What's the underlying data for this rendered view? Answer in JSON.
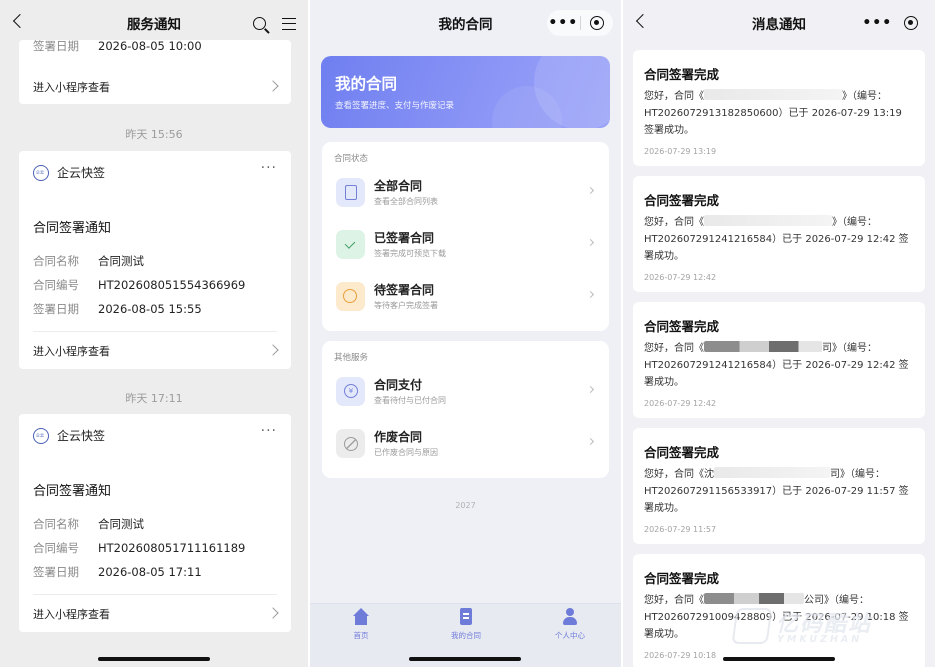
{
  "panel1": {
    "title": "服务通知",
    "cut_row": {
      "label": "签署日期",
      "value": "2026-08-05 10:00"
    },
    "top_link": "进入小程序查看",
    "notices": [
      {
        "time": "昨天 15:56",
        "sender": "企云快签",
        "more": "···",
        "title": "合同签署通知",
        "fields": [
          {
            "label": "合同名称",
            "value": "合同测试"
          },
          {
            "label": "合同编号",
            "value": "HT202608051554366969"
          },
          {
            "label": "签署日期",
            "value": "2026-08-05 15:55"
          }
        ],
        "link": "进入小程序查看"
      },
      {
        "time": "昨天 17:11",
        "sender": "企云快签",
        "more": "···",
        "title": "合同签署通知",
        "fields": [
          {
            "label": "合同名称",
            "value": "合同测试"
          },
          {
            "label": "合同编号",
            "value": "HT202608051711161189"
          },
          {
            "label": "签署日期",
            "value": "2026-08-05 17:11"
          }
        ],
        "link": "进入小程序查看"
      }
    ]
  },
  "panel2": {
    "title": "我的合同",
    "capsule_dots": "•••",
    "hero": {
      "title": "我的合同",
      "subtitle": "查看签署进度、支付与作废记录"
    },
    "status_section": {
      "title": "合同状态",
      "items": [
        {
          "label": "全部合同",
          "desc": "查看全部合同列表",
          "icon": "document-icon"
        },
        {
          "label": "已签署合同",
          "desc": "签署完成可预览下载",
          "icon": "check-icon"
        },
        {
          "label": "待签署合同",
          "desc": "等待客户完成签署",
          "icon": "clock-icon"
        }
      ]
    },
    "other_section": {
      "title": "其他服务",
      "items": [
        {
          "label": "合同支付",
          "desc": "查看待付与已付合同",
          "icon": "yuan-icon"
        },
        {
          "label": "作废合同",
          "desc": "已作废合同与原因",
          "icon": "void-icon"
        }
      ]
    },
    "year": "2027",
    "tabs": [
      {
        "label": "首页",
        "icon": "home-icon"
      },
      {
        "label": "我的合同",
        "icon": "contract-icon"
      },
      {
        "label": "个人中心",
        "icon": "user-icon"
      }
    ],
    "accent": "#6f7bd8"
  },
  "panel3": {
    "title": "消息通知",
    "capsule_dots": "•••",
    "messages": [
      {
        "title": "合同签署完成",
        "prefix": "您好，合同《",
        "suffix": "》（编号：",
        "code": "HT2026072913182850600",
        "sign_text": "）已于 2026-07-29 13:19 签署成功。",
        "time": "2026-07-29 13:19"
      },
      {
        "title": "合同签署完成",
        "prefix": "您好，合同《",
        "suffix": "》（编号：",
        "code": "HT202607291241216584",
        "sign_text": "）已于 2026-07-29 12:42 签署成功。",
        "time": "2026-07-29 12:42"
      },
      {
        "title": "合同签署完成",
        "prefix": "您好，合同《",
        "suffix": "司》（编号：",
        "code": "HT202607291241216584",
        "sign_text": "）已于 2026-07-29 12:42 签署成功。",
        "time": "2026-07-29 12:42"
      },
      {
        "title": "合同签署完成",
        "prefix": "您好，合同《沈",
        "suffix": "司》（编号：",
        "code": "HT202607291156533917",
        "sign_text": "）已于 2026-07-29 11:57 签署成功。",
        "time": "2026-07-29 11:57"
      },
      {
        "title": "合同签署完成",
        "prefix": "您好，合同《",
        "suffix": "公司》（编号：",
        "code": "HT202607291009428809",
        "sign_text": "）已于 2026-07-29 10:18 签署成功。",
        "time": "2026-07-29 10:18"
      }
    ],
    "watermark": {
      "brand": "亿码酷站",
      "sub": "YMKUZHAN"
    }
  }
}
